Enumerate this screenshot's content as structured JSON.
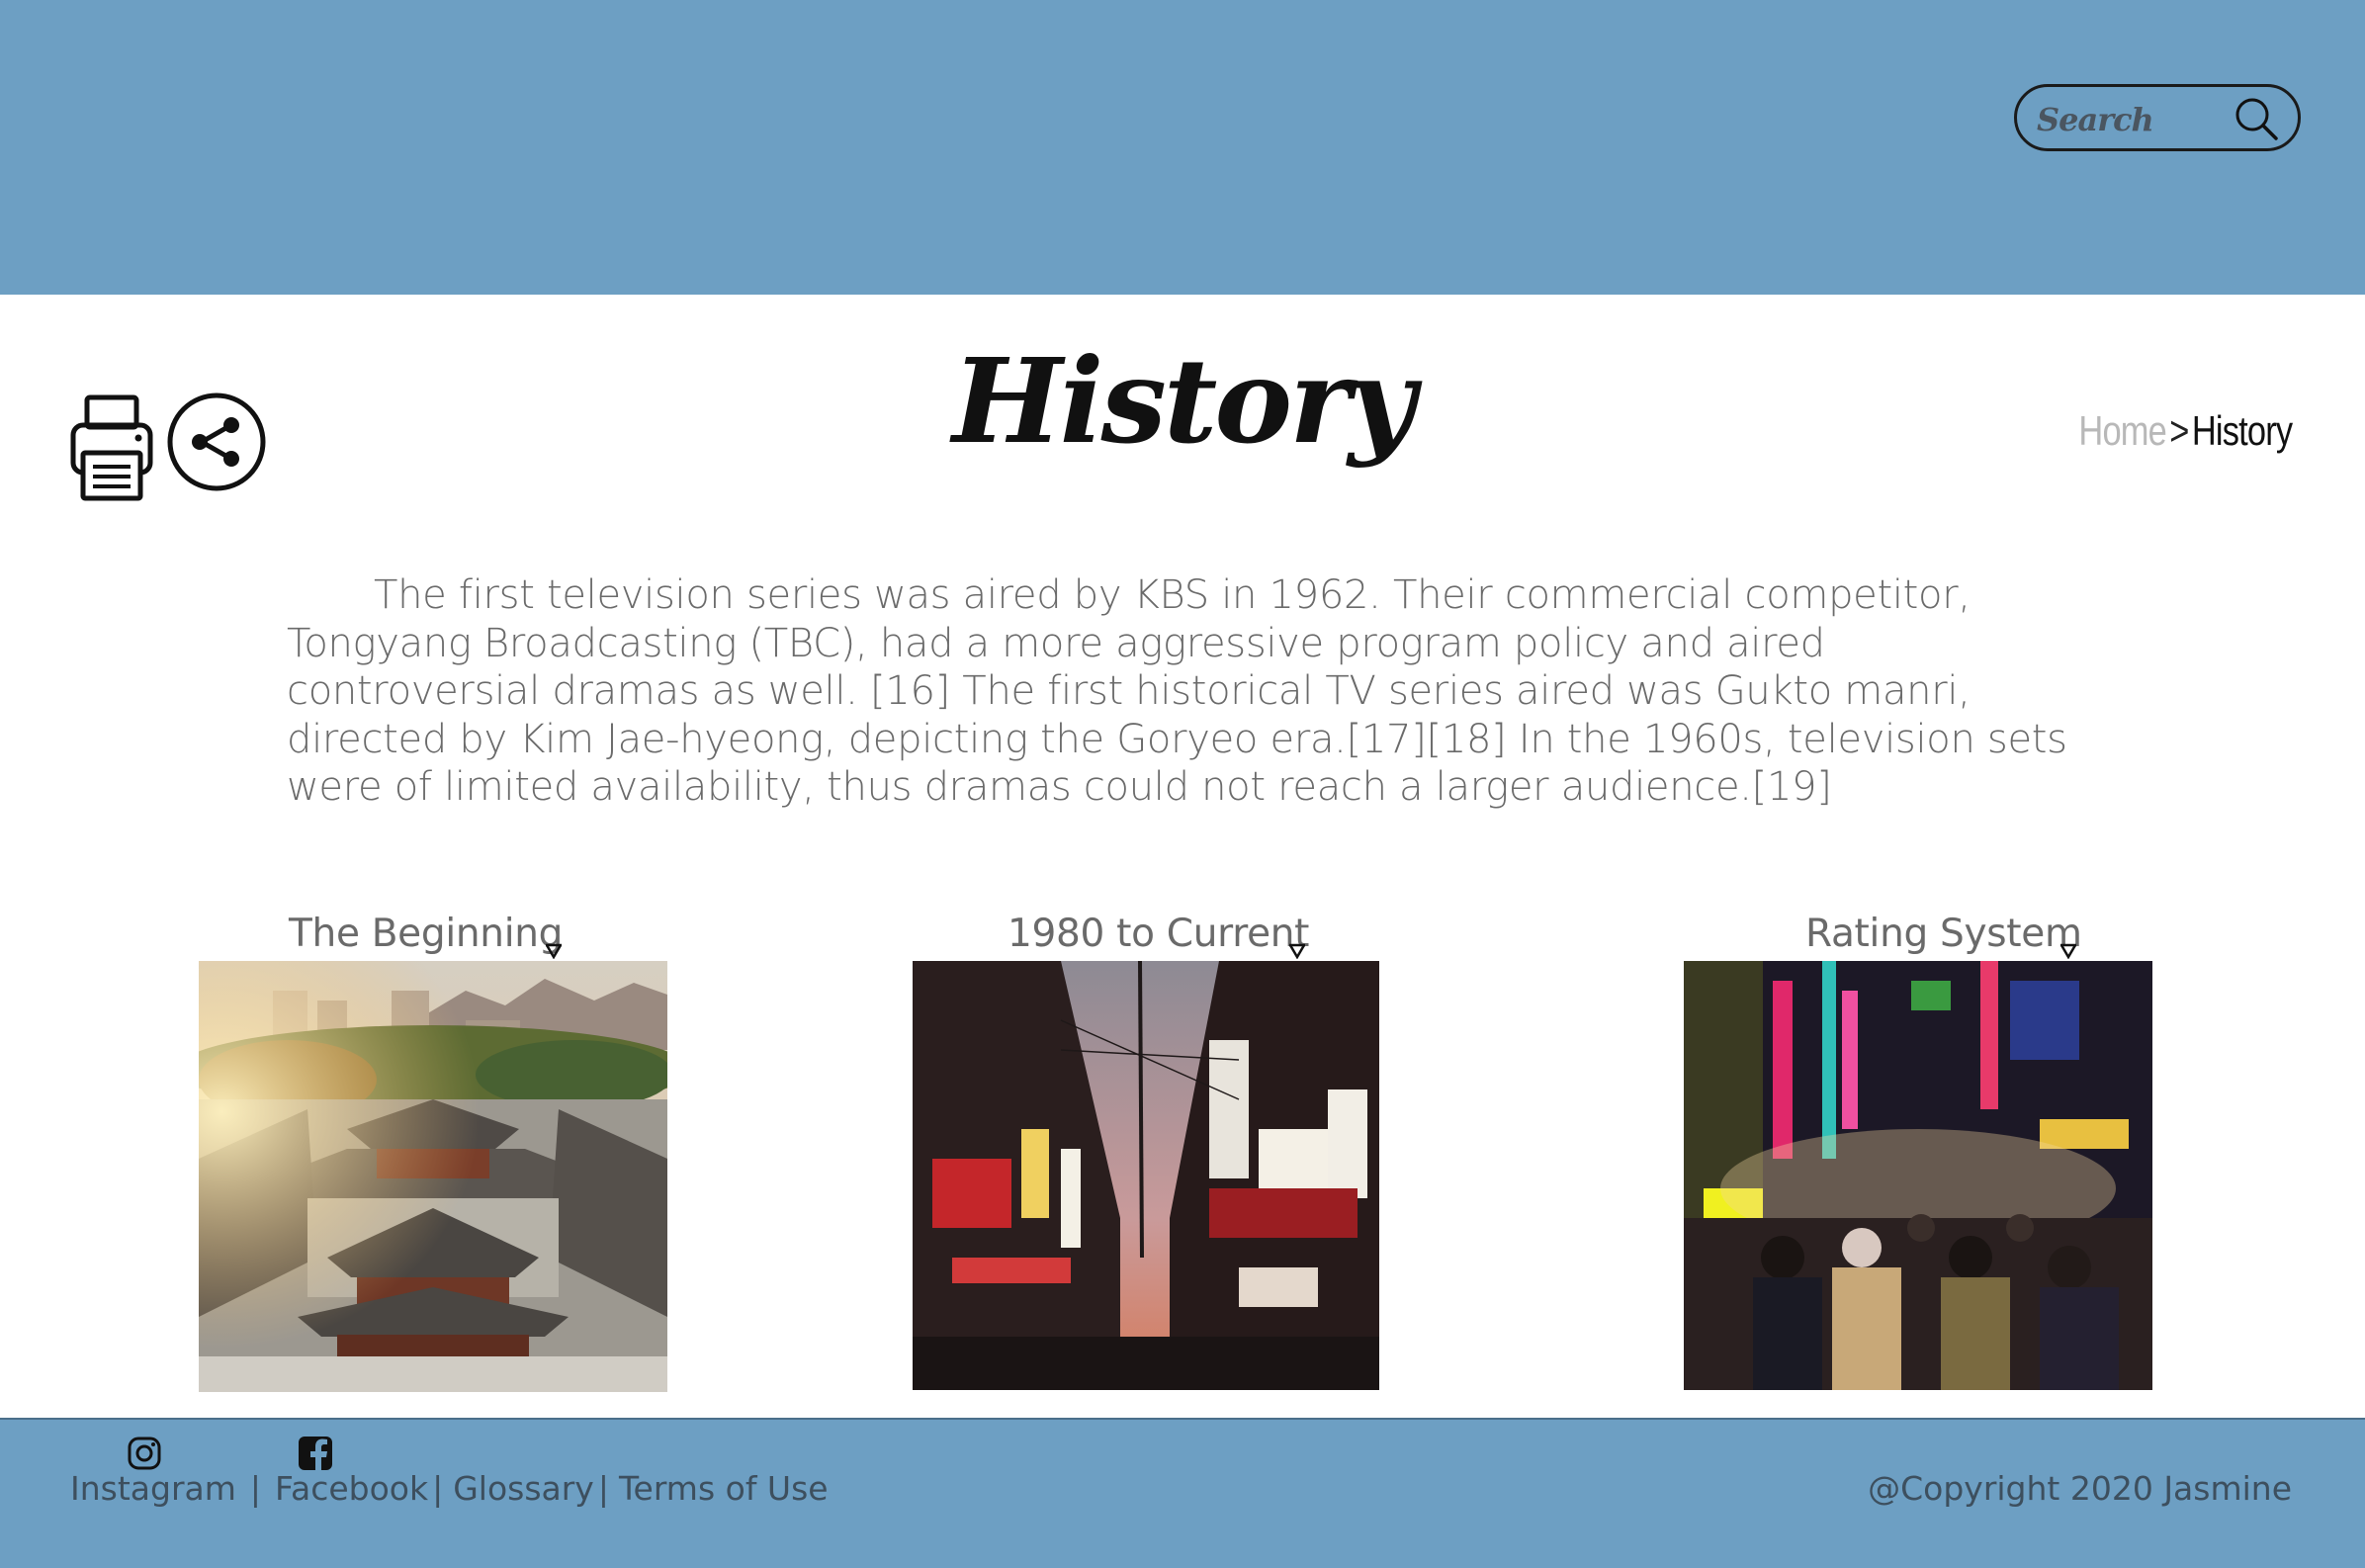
{
  "header": {
    "search_placeholder": "Search"
  },
  "page": {
    "title": "History",
    "breadcrumb": {
      "home": "Home",
      "separator": ">",
      "current": "History"
    },
    "intro": "The first television series was aired by KBS in 1962. Their commercial competitor, Tongyang Broadcasting (TBC), had a more aggressive program policy and aired controversial dramas as well. [16] The first historical TV series aired was Gukto manri, directed by Kim Jae-hyeong, depicting the Goryeo era.[17][18] In the 1960s, television sets were of limited availability, thus dramas could not reach a larger audience.[19]"
  },
  "tools": [
    "printer-icon",
    "share-icon"
  ],
  "cards": [
    {
      "label": "The Beginning",
      "image": "palace-photo"
    },
    {
      "label": "1980 to Current",
      "image": "street-dusk-photo"
    },
    {
      "label": "Rating System",
      "image": "night-market-photo"
    }
  ],
  "footer": {
    "links": [
      "Instagram",
      "Facebook",
      "Glossary",
      "Terms of Use"
    ],
    "separator": "|",
    "copyright": "@Copyright 2020 Jasmine",
    "icons": [
      "instagram-icon",
      "facebook-icon"
    ]
  },
  "colors": {
    "header_bg": "#6d9fc3",
    "footer_bg": "#6d9fc3",
    "body_text": "#6a6a6a"
  }
}
